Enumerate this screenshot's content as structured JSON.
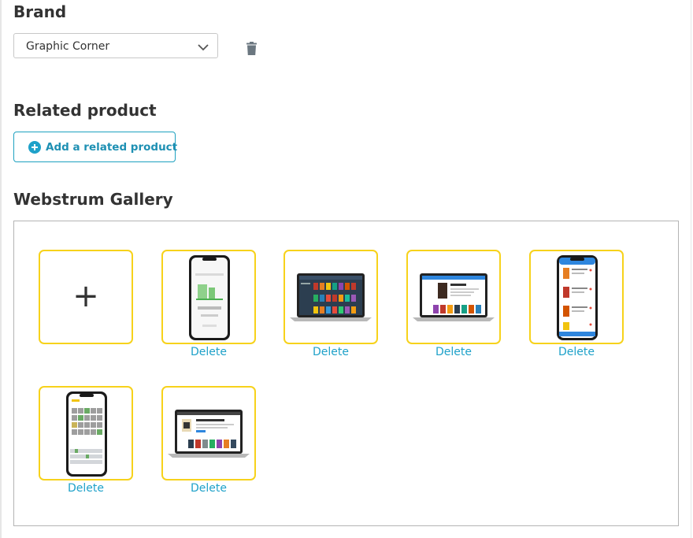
{
  "brand": {
    "heading": "Brand",
    "selected": "Graphic Corner"
  },
  "related": {
    "heading": "Related product",
    "add_label": "Add a related product"
  },
  "gallery": {
    "heading": "Webstrum Gallery",
    "add_symbol": "+",
    "delete_label": "Delete",
    "images": [
      {
        "device": "phone",
        "content": "gauge-app"
      },
      {
        "device": "laptop",
        "content": "movie-grid"
      },
      {
        "device": "laptop",
        "content": "movie-detail"
      },
      {
        "device": "phone",
        "content": "book-list"
      },
      {
        "device": "phone",
        "content": "wordle-game"
      },
      {
        "device": "laptop",
        "content": "book-detail"
      }
    ]
  },
  "colors": {
    "accent": "#1ea1c0",
    "tile_border": "#f7d21b",
    "heading": "#333333"
  }
}
